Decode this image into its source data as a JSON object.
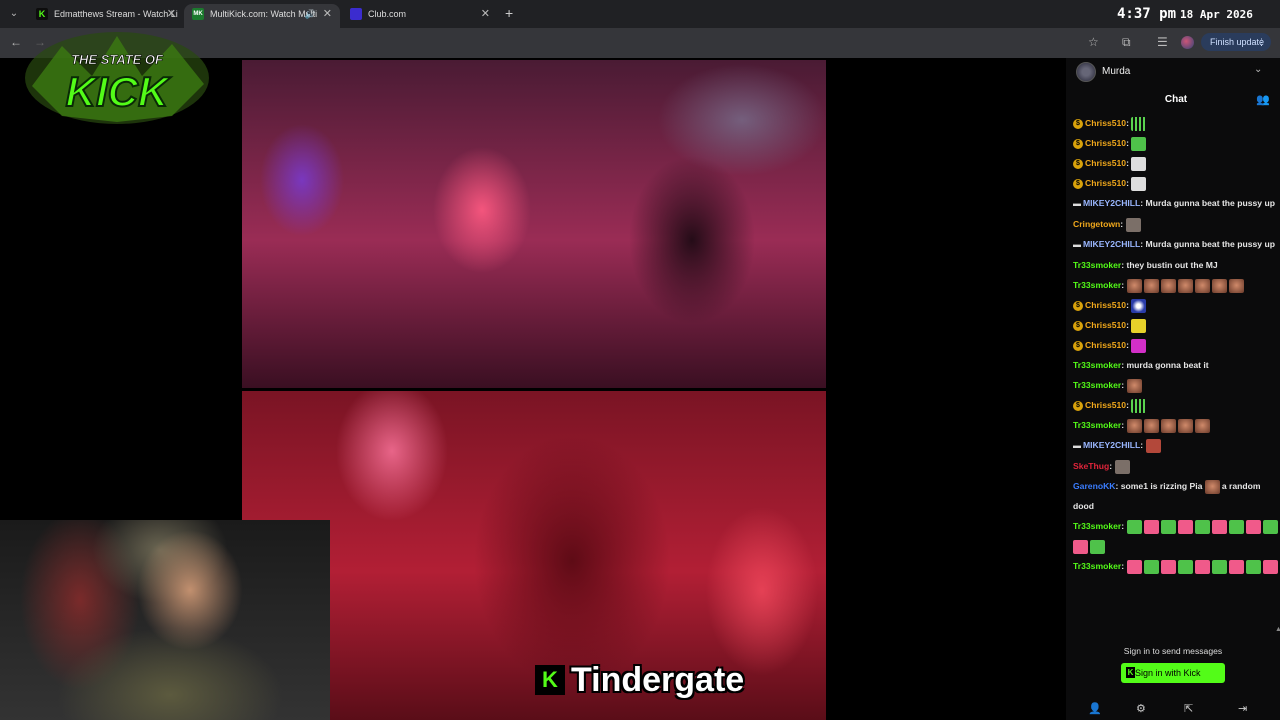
{
  "browser": {
    "tabs": [
      {
        "title": "Edmatthews Stream - Watch Li",
        "favicon_color": "#53fc18",
        "favicon_text": "K"
      },
      {
        "title": "MultiKick.com: Watch Multi",
        "favicon_color": "#1c7a2e",
        "favicon_text": "MK"
      },
      {
        "title": "Club.com",
        "favicon_color": "#3b2ccf",
        "favicon_text": ""
      }
    ],
    "new_tab_label": "+",
    "finish_update_label": "Finish update",
    "icons": [
      "back-arrow-icon",
      "forward-arrow-icon",
      "bookmark-star-icon",
      "extensions-icon",
      "reading-list-icon",
      "profile-avatar-icon",
      "menu-dots-icon"
    ]
  },
  "clock": {
    "time": "4:37 pm",
    "date": "18 Apr 2026"
  },
  "overlay": {
    "logo_line1": "THE STATE OF",
    "logo_line2": "KICK",
    "caption_badge": "K",
    "caption_word": "Tindergate"
  },
  "chat": {
    "channel_name": "Murda",
    "title": "Chat",
    "messages": [
      {
        "user": "Chriss510",
        "color": "#f0a81c",
        "badge": "sub",
        "text": "",
        "emotes": [
          "eq"
        ]
      },
      {
        "user": "Chriss510",
        "color": "#f0a81c",
        "badge": "sub",
        "text": "",
        "emotes": [
          "green"
        ]
      },
      {
        "user": "Chriss510",
        "color": "#f0a81c",
        "badge": "sub",
        "text": "",
        "emotes": [
          "white"
        ]
      },
      {
        "user": "Chriss510",
        "color": "#f0a81c",
        "badge": "sub",
        "text": "",
        "emotes": [
          "white"
        ]
      },
      {
        "user": "MIKEY2CHILL",
        "color": "#9ab7ff",
        "badge": "hat",
        "text": "Murda gunna beat the pussy up",
        "emotes": []
      },
      {
        "user": "Cringetown",
        "color": "#f0a81c",
        "badge": "",
        "text": "",
        "emotes": [
          "grey"
        ]
      },
      {
        "user": "MIKEY2CHILL",
        "color": "#9ab7ff",
        "badge": "hat",
        "text": "Murda gunna beat the pussy up",
        "emotes": []
      },
      {
        "user": "Tr33smoker",
        "color": "#53fc18",
        "badge": "",
        "text": "they bustin out the MJ",
        "emotes": []
      },
      {
        "user": "Tr33smoker",
        "color": "#53fc18",
        "badge": "",
        "text": "",
        "emotes": [
          "face",
          "face",
          "face",
          "face",
          "face",
          "face",
          "face"
        ]
      },
      {
        "user": "Chriss510",
        "color": "#f0a81c",
        "badge": "sub",
        "text": "",
        "emotes": [
          "blue"
        ]
      },
      {
        "user": "Chriss510",
        "color": "#f0a81c",
        "badge": "sub",
        "text": "",
        "emotes": [
          "yellow"
        ]
      },
      {
        "user": "Chriss510",
        "color": "#f0a81c",
        "badge": "sub",
        "text": "",
        "emotes": [
          "mag"
        ]
      },
      {
        "user": "Tr33smoker",
        "color": "#53fc18",
        "badge": "",
        "text": "murda gonna beat it",
        "emotes": []
      },
      {
        "user": "Tr33smoker",
        "color": "#53fc18",
        "badge": "",
        "text": "",
        "emotes": [
          "face"
        ]
      },
      {
        "user": "Chriss510",
        "color": "#f0a81c",
        "badge": "sub",
        "text": "",
        "emotes": [
          "eq"
        ]
      },
      {
        "user": "Tr33smoker",
        "color": "#53fc18",
        "badge": "",
        "text": "",
        "emotes": [
          "face",
          "face",
          "face",
          "face",
          "face"
        ]
      },
      {
        "user": "MIKEY2CHILL",
        "color": "#9ab7ff",
        "badge": "hat",
        "text": "",
        "emotes": [
          "red"
        ]
      },
      {
        "user": "SkeThug",
        "color": "#e0243a",
        "badge": "",
        "text": "",
        "emotes": [
          "grey"
        ]
      },
      {
        "user": "GarenoKK",
        "color": "#3a7dff",
        "badge": "",
        "text": "some1 is rizzing Pia",
        "emotes": [
          "face"
        ],
        "after_text": "a random dood"
      },
      {
        "user": "Tr33smoker",
        "color": "#53fc18",
        "badge": "",
        "text": "",
        "emotes": [
          "green",
          "pink",
          "green",
          "pink",
          "green",
          "pink",
          "green",
          "pink",
          "green",
          "pink",
          "green"
        ]
      },
      {
        "user": "Tr33smoker",
        "color": "#53fc18",
        "badge": "",
        "text": "",
        "emotes": [
          "pink",
          "green",
          "pink",
          "green",
          "pink",
          "green",
          "pink",
          "green",
          "pink"
        ]
      }
    ],
    "signin_prompt": "Sign in to send messages",
    "signin_button": "Sign in with Kick",
    "signin_badge": "K"
  }
}
